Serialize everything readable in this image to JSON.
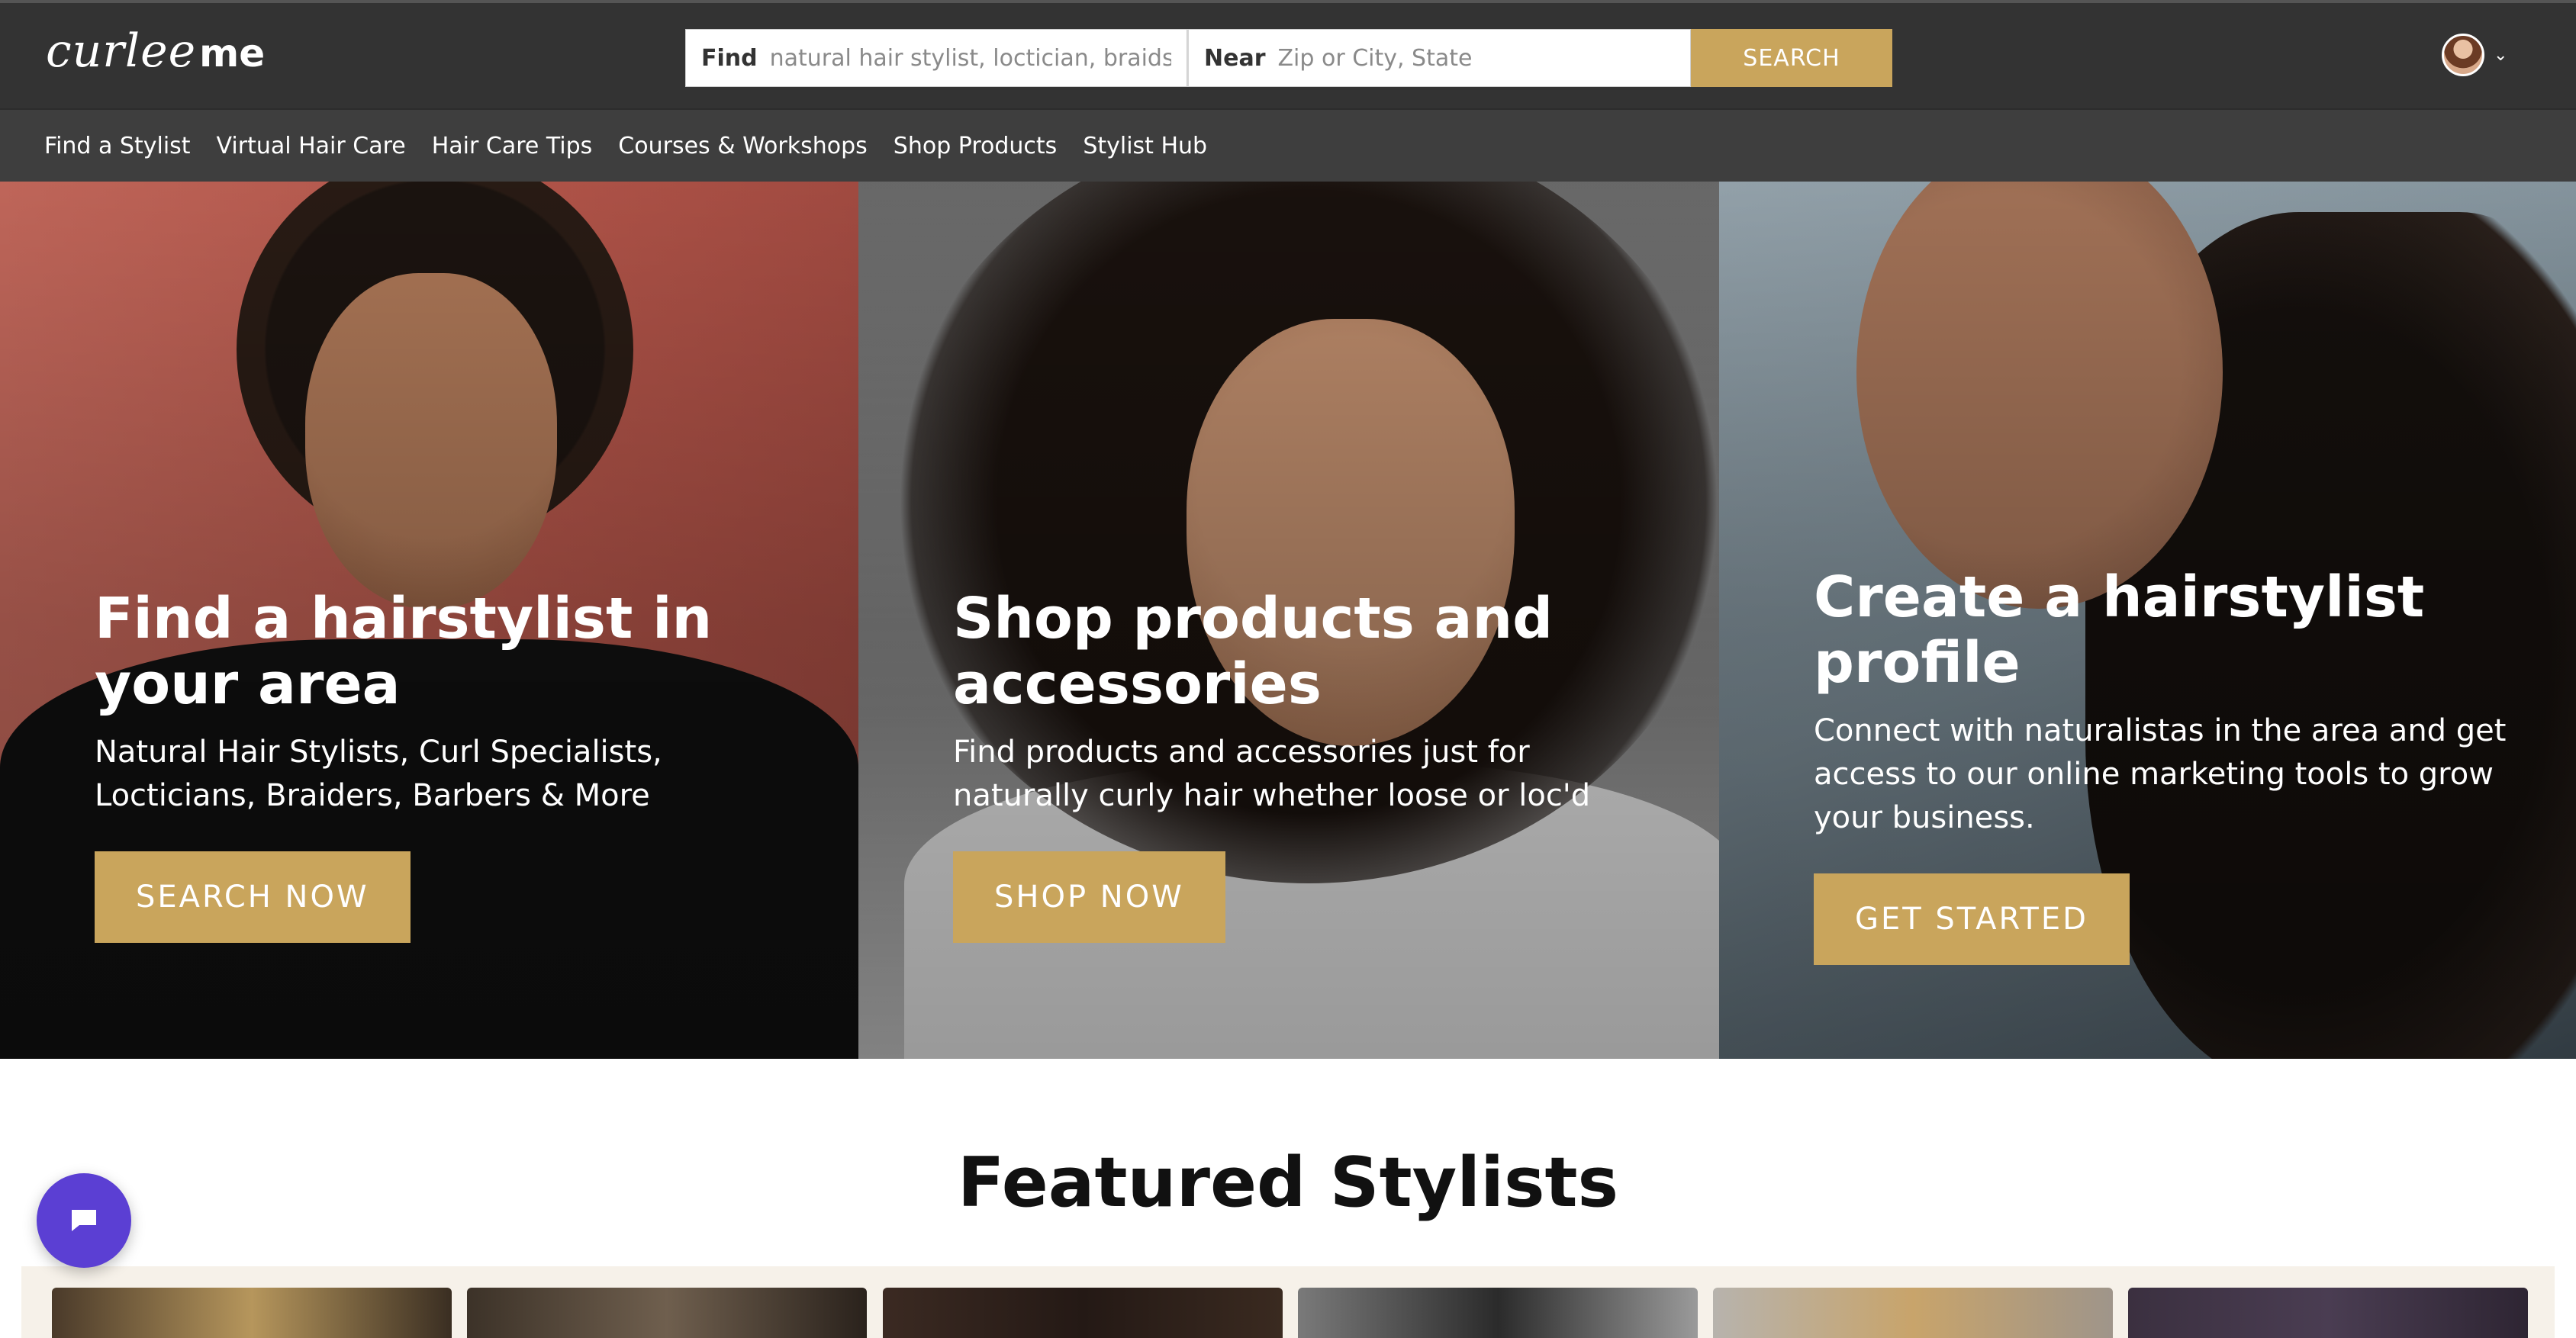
{
  "header": {
    "logo_script": "curlee",
    "logo_bold": "me",
    "search": {
      "find_label": "Find",
      "find_placeholder": "natural hair stylist, loctician, braids...",
      "near_label": "Near",
      "near_placeholder": "Zip or City, State",
      "button_label": "SEARCH"
    },
    "avatar_caret": "⌄"
  },
  "nav": {
    "items": [
      {
        "label": "Find a Stylist"
      },
      {
        "label": "Virtual Hair Care"
      },
      {
        "label": "Hair Care Tips"
      },
      {
        "label": "Courses & Workshops"
      },
      {
        "label": "Shop Products"
      },
      {
        "label": "Stylist Hub"
      }
    ]
  },
  "hero": {
    "panels": [
      {
        "title": "Find a hairstylist in your area",
        "subtitle": "Natural Hair Stylists, Curl Specialists, Locticians, Braiders, Barbers & More",
        "cta": "SEARCH NOW"
      },
      {
        "title": "Shop products and accessories",
        "subtitle": "Find products and accessories just for naturally curly hair whether loose or loc'd",
        "cta": "SHOP NOW"
      },
      {
        "title": "Create a hairstylist profile",
        "subtitle": "Connect with naturalistas in the area and get access to our online marketing tools to grow your business.",
        "cta": "GET STARTED"
      }
    ]
  },
  "featured": {
    "title": "Featured Stylists"
  },
  "colors": {
    "accent": "#c9a55c",
    "topbar": "#333333",
    "navbar": "#3e3e3e",
    "chat": "#5b3fd3"
  },
  "icons": {
    "chat": "chat-bubble-icon",
    "caret": "chevron-down-icon",
    "avatar": "user-avatar"
  }
}
